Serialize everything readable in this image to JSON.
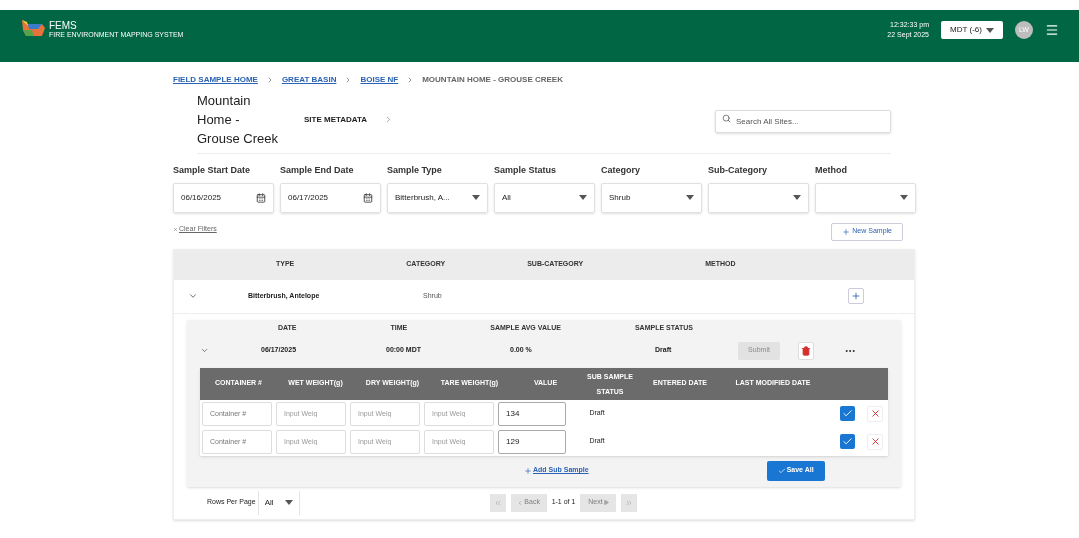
{
  "header": {
    "app_name": "FEMS",
    "app_subtitle": "FIRE ENVIRONMENT MAPPING SYSTEM",
    "time": "12:32:33 pm",
    "date": "22 Sept 2025",
    "timezone": "MDT (-6)",
    "avatar_initials": "LW"
  },
  "breadcrumbs": [
    {
      "label": "FIELD SAMPLE HOME",
      "link": true
    },
    {
      "label": "GREAT BASIN",
      "link": true
    },
    {
      "label": "BOISE NF",
      "link": true
    },
    {
      "label": "MOUNTAIN HOME - GROUSE CREEK",
      "link": false
    }
  ],
  "site": {
    "title": "Mountain Home - Grouse Creek",
    "metadata_label": "SITE METADATA"
  },
  "search": {
    "placeholder": "Search All Sites..."
  },
  "filters": [
    {
      "label": "Sample Start Date",
      "kind": "date",
      "value": "06/16/2025"
    },
    {
      "label": "Sample End Date",
      "kind": "date",
      "value": "06/17/2025"
    },
    {
      "label": "Sample Type",
      "kind": "select",
      "value": "Bitterbrush, A..."
    },
    {
      "label": "Sample Status",
      "kind": "select",
      "value": "All"
    },
    {
      "label": "Category",
      "kind": "select",
      "value": "Shrub"
    },
    {
      "label": "Sub-Category",
      "kind": "select"
    },
    {
      "label": "Method",
      "kind": "select"
    }
  ],
  "clear_filters": "Clear Filters",
  "new_sample": "New Sample",
  "table": {
    "columns": [
      "TYPE",
      "CATEGORY",
      "SUB-CATEGORY",
      "METHOD"
    ],
    "rows": [
      {
        "type": "Bitterbrush, Antelope",
        "category": "Shrub",
        "expanded": true,
        "samples": {
          "columns": [
            "DATE",
            "TIME",
            "SAMPLE AVG VALUE",
            "SAMPLE STATUS"
          ],
          "rows": [
            {
              "date": "06/17/2025",
              "time": "00:00 MDT",
              "avg": "0.00 %",
              "status": "Draft",
              "submit": "Submit",
              "submit_disabled": true,
              "expanded": true,
              "sub_samples": {
                "columns": [
                  "CONTAINER #",
                  "WET WEIGHT(g)",
                  "DRY WEIGHT(g)",
                  "TARE WEIGHT(g)",
                  "VALUE",
                  "SUB SAMPLE STATUS",
                  "ENTERED DATE",
                  "LAST MODIFIED DATE"
                ],
                "rows": [
                  {
                    "container_placeholder": "Container #",
                    "wet_placeholder": "Input Weig",
                    "dry_placeholder": "Input Weig",
                    "tare_placeholder": "Input Weig",
                    "value": "134",
                    "status": "Draft"
                  },
                  {
                    "container_placeholder": "Container #",
                    "wet_placeholder": "Input Weig",
                    "dry_placeholder": "Input Weig",
                    "tare_placeholder": "Input Weig",
                    "value": "129",
                    "status": "Draft"
                  }
                ],
                "add_label": "Add Sub Sample",
                "save_label": "Save All"
              }
            }
          ]
        }
      }
    ]
  },
  "pagination": {
    "rows_per_page_label": "Rows Per Page",
    "rows_per_page": "All",
    "back": "Back",
    "range": "1-1 of 1",
    "next": "Next"
  }
}
